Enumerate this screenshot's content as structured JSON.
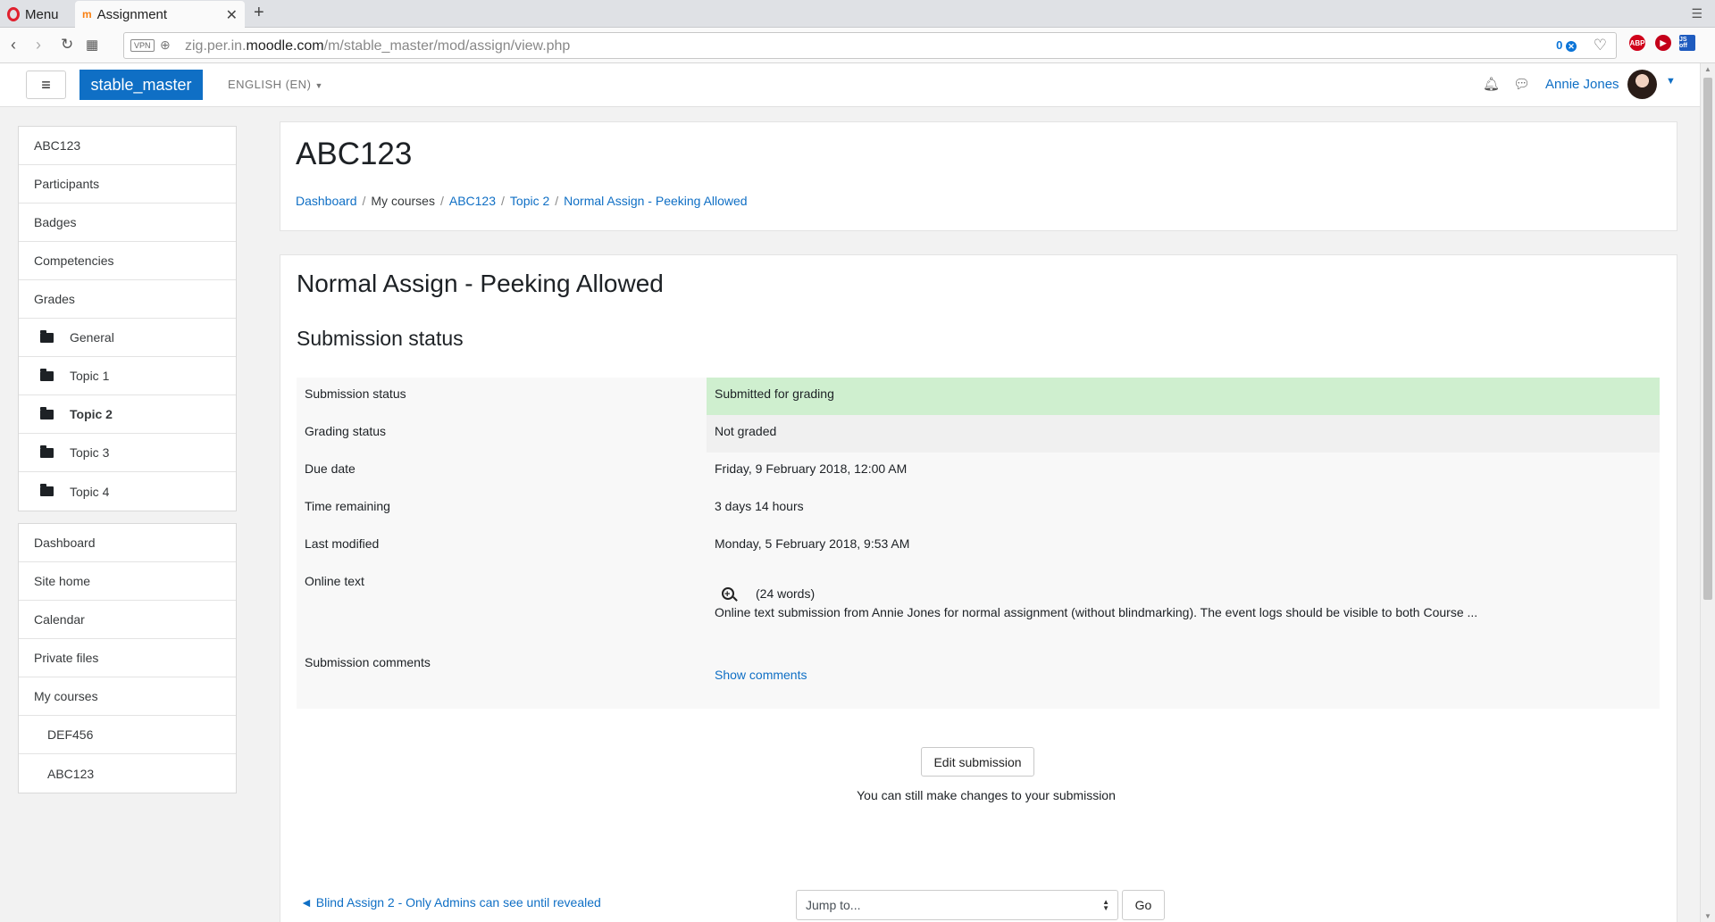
{
  "browser": {
    "menu_label": "Menu",
    "tab_title": "Assignment",
    "tab_favicon": "m",
    "url_prefix": "zig.per.in.",
    "url_host": "moodle.com",
    "url_path": "/m/stable_master/mod/assign/view.php",
    "vpn_badge": "VPN",
    "blocked_count": "0",
    "ext_abp": "ABP",
    "ext_js": "JS off"
  },
  "navbar": {
    "site_name": "stable_master",
    "language": "ENGLISH (EN)",
    "user_name": "Annie Jones"
  },
  "sidebar": {
    "course_block": [
      {
        "label": "ABC123",
        "style": "plain"
      },
      {
        "label": "Participants",
        "style": "plain"
      },
      {
        "label": "Badges",
        "style": "plain"
      },
      {
        "label": "Competencies",
        "style": "plain"
      },
      {
        "label": "Grades",
        "style": "plain"
      },
      {
        "label": "General",
        "style": "folder"
      },
      {
        "label": "Topic 1",
        "style": "folder"
      },
      {
        "label": "Topic 2",
        "style": "folder-bold"
      },
      {
        "label": "Topic 3",
        "style": "folder"
      },
      {
        "label": "Topic 4",
        "style": "folder"
      }
    ],
    "nav_block": [
      {
        "label": "Dashboard",
        "style": "plain"
      },
      {
        "label": "Site home",
        "style": "plain"
      },
      {
        "label": "Calendar",
        "style": "plain"
      },
      {
        "label": "Private files",
        "style": "plain"
      },
      {
        "label": "My courses",
        "style": "plain"
      },
      {
        "label": "DEF456",
        "style": "indent"
      },
      {
        "label": "ABC123",
        "style": "indent"
      }
    ]
  },
  "header": {
    "course_title": "ABC123",
    "breadcrumb": [
      "Dashboard",
      "My courses",
      "ABC123",
      "Topic 2",
      "Normal Assign - Peeking Allowed"
    ]
  },
  "main": {
    "activity_title": "Normal Assign - Peeking Allowed",
    "section_title": "Submission status",
    "rows": {
      "submission_status": {
        "label": "Submission status",
        "value": "Submitted for grading"
      },
      "grading_status": {
        "label": "Grading status",
        "value": "Not graded"
      },
      "due_date": {
        "label": "Due date",
        "value": "Friday, 9 February 2018, 12:00 AM"
      },
      "time_remaining": {
        "label": "Time remaining",
        "value": "3 days 14 hours"
      },
      "last_modified": {
        "label": "Last modified",
        "value": "Monday, 5 February 2018, 9:53 AM"
      },
      "online_text": {
        "label": "Online text",
        "word_count": "(24 words)",
        "excerpt": "Online text submission from Annie Jones for normal assignment (without blindmarking). The event logs should be visible to both Course ..."
      },
      "comments": {
        "label": "Submission comments",
        "link": "Show comments"
      }
    },
    "edit_button": "Edit submission",
    "edit_note": "You can still make changes to your submission",
    "prev_activity": "◄ Blind Assign 2 - Only Admins can see until revealed",
    "jump_placeholder": "Jump to...",
    "go_button": "Go"
  },
  "colors": {
    "brand": "#0f6fc5",
    "submitted_bg": "#cfefcf",
    "link": "#0f6fc5"
  }
}
